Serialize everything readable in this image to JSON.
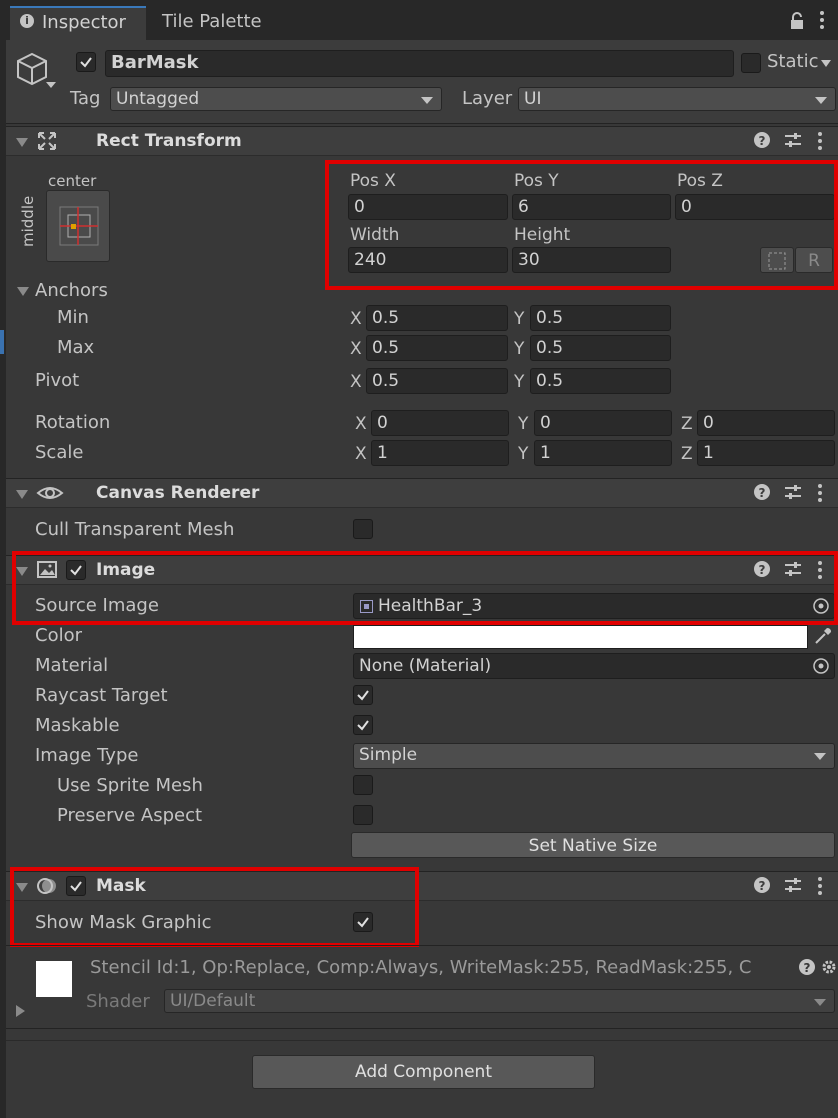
{
  "tabs": {
    "inspector": "Inspector",
    "tile_palette": "Tile Palette"
  },
  "object": {
    "name": "BarMask",
    "static_label": "Static",
    "tag_label": "Tag",
    "tag_value": "Untagged",
    "layer_label": "Layer",
    "layer_value": "UI"
  },
  "rect": {
    "title": "Rect Transform",
    "anchor_h": "center",
    "anchor_v": "middle",
    "posx_label": "Pos X",
    "posy_label": "Pos Y",
    "posz_label": "Pos Z",
    "posx": "0",
    "posy": "6",
    "posz": "0",
    "width_label": "Width",
    "height_label": "Height",
    "width": "240",
    "height": "30",
    "r_label": "R",
    "anchors_label": "Anchors",
    "min_label": "Min",
    "max_label": "Max",
    "pivot_label": "Pivot",
    "min_x": "0.5",
    "min_y": "0.5",
    "max_x": "0.5",
    "max_y": "0.5",
    "pivot_x": "0.5",
    "pivot_y": "0.5",
    "rotation_label": "Rotation",
    "scale_label": "Scale",
    "rot_x": "0",
    "rot_y": "0",
    "rot_z": "0",
    "scale_x": "1",
    "scale_y": "1",
    "scale_z": "1",
    "x": "X",
    "y": "Y",
    "z": "Z"
  },
  "canvas_renderer": {
    "title": "Canvas Renderer",
    "cull_label": "Cull Transparent Mesh"
  },
  "image": {
    "title": "Image",
    "source_label": "Source Image",
    "source_value": "HealthBar_3",
    "color_label": "Color",
    "color_value": "#ffffff",
    "material_label": "Material",
    "material_value": "None (Material)",
    "raycast_label": "Raycast Target",
    "maskable_label": "Maskable",
    "type_label": "Image Type",
    "type_value": "Simple",
    "sprite_mesh_label": "Use Sprite Mesh",
    "preserve_label": "Preserve Aspect",
    "native_button": "Set Native Size"
  },
  "mask": {
    "title": "Mask",
    "show_label": "Show Mask Graphic"
  },
  "material": {
    "info": "Stencil Id:1, Op:Replace, Comp:Always, WriteMask:255, ReadMask:255, C",
    "shader_label": "Shader",
    "shader_value": "UI/Default"
  },
  "add_component": "Add Component",
  "colors": {
    "highlight": "#e00000",
    "panel": "#383838",
    "field": "#2a2a2a"
  }
}
